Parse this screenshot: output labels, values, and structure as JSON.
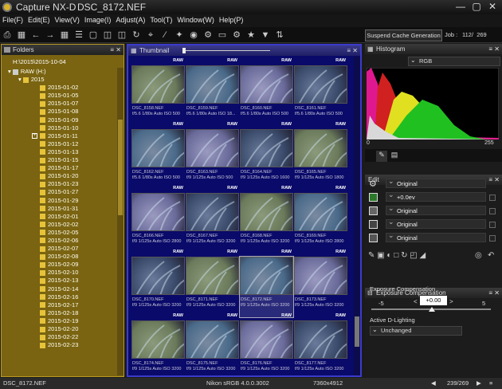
{
  "window": {
    "app": "Capture NX-D",
    "file": "DSC_8172.NEF"
  },
  "menu": [
    "File(F)",
    "Edit(E)",
    "View(V)",
    "Image(I)",
    "Adjust(A)",
    "Tool(T)",
    "Window(W)",
    "Help(P)"
  ],
  "toolbar": {
    "cache_button": "Suspend Cache Generation",
    "job_label": "Job :",
    "job_count": "112/  269"
  },
  "folders": {
    "title": "Folders",
    "path": "H:\\2015\\2015-10-04",
    "drive": "RAW (H:)",
    "year": "2015",
    "items": [
      "2015-01-02",
      "2015-01-05",
      "2015-01-07",
      "2015-01-08",
      "2015-01-09",
      "2015-01-10",
      "2015-01-11",
      "2015-01-12",
      "2015-01-13",
      "2015-01-15",
      "2015-01-17",
      "2015-01-20",
      "2015-01-23",
      "2015-01-27",
      "2015-01-29",
      "2015-01-31",
      "2015-02-01",
      "2015-02-02",
      "2015-02-05",
      "2015-02-06",
      "2015-02-07",
      "2015-02-08",
      "2015-02-09",
      "2015-02-10",
      "2015-02-13",
      "2015-02-14",
      "2015-02-16",
      "2015-02-17",
      "2015-02-18",
      "2015-02-19",
      "2015-02-20",
      "2015-02-22",
      "2015-02-23"
    ]
  },
  "thumbs": {
    "title": "Thumbnail",
    "badge": "RAW",
    "selected": "DSC_8172.NEF",
    "rows": [
      [
        {
          "n": "DSC_8158.NEF",
          "i": "f/5.6 1/80s Auto ISO 500"
        },
        {
          "n": "DSC_8159.NEF",
          "i": "f/5.6 1/80s Auto ISO 18..."
        },
        {
          "n": "DSC_8160.NEF",
          "i": "f/5.6 1/80s Auto ISO 500"
        },
        {
          "n": "DSC_8161.NEF",
          "i": "f/5.6 1/80s Auto ISO 500"
        }
      ],
      [
        {
          "n": "DSC_8162.NEF",
          "i": "f/5.6 1/80s Auto ISO 500"
        },
        {
          "n": "DSC_8163.NEF",
          "i": "f/9 1/125s Auto ISO 500"
        },
        {
          "n": "DSC_8164.NEF",
          "i": "f/9 1/125s Auto ISO 1600"
        },
        {
          "n": "DSC_8165.NEF",
          "i": "f/9 1/125s Auto ISO 1800"
        }
      ],
      [
        {
          "n": "DSC_8166.NEF",
          "i": "f/9 1/125s Auto ISO 2800"
        },
        {
          "n": "DSC_8167.NEF",
          "i": "f/9 1/125s Auto ISO 3200"
        },
        {
          "n": "DSC_8168.NEF",
          "i": "f/9 1/125s Auto ISO 3200"
        },
        {
          "n": "DSC_8169.NEF",
          "i": "f/9 1/125s Auto ISO 2800"
        }
      ],
      [
        {
          "n": "DSC_8170.NEF",
          "i": "f/9 1/125s Auto ISO 3200"
        },
        {
          "n": "DSC_8171.NEF",
          "i": "f/9 1/125s Auto ISO 3200"
        },
        {
          "n": "DSC_8172.NEF",
          "i": "f/9 1/125s Auto ISO 3200"
        },
        {
          "n": "DSC_8173.NEF",
          "i": "f/9 1/125s Auto ISO 3200"
        }
      ],
      [
        {
          "n": "DSC_8174.NEF",
          "i": "f/9 1/125s Auto ISO 3200"
        },
        {
          "n": "DSC_8175.NEF",
          "i": "f/9 1/125s Auto ISO 3200"
        },
        {
          "n": "DSC_8176.NEF",
          "i": "f/9 1/125s Auto ISO 3200"
        },
        {
          "n": "DSC_8177.NEF",
          "i": "f/9 1/125s Auto ISO 3200"
        }
      ]
    ]
  },
  "histogram": {
    "title": "Histogram",
    "channel": "RGB",
    "min": "0",
    "max": "255"
  },
  "edit": {
    "title": "Edit",
    "rows": [
      "Original",
      "+0.0ev",
      "Original",
      "Original",
      "Original"
    ]
  },
  "exposure": {
    "title": "Exposure Compensation",
    "label": "Exposure Compensation",
    "min": "-5",
    "max": "5",
    "value": "+0.00",
    "adl_label": "Active D-Lighting",
    "adl_value": "Unchanged"
  },
  "status": {
    "file": "DSC_8172.NEF",
    "profile": "Nikon sRGB 4.0.0.3002",
    "size": "7360x4912",
    "counter": "239/269"
  }
}
